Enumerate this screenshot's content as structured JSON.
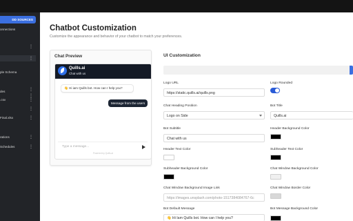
{
  "sidebar": {
    "add_button": "DD SOURCES",
    "items": [
      "onnections",
      "",
      "",
      "",
      "ple Schema",
      "",
      "",
      "des",
      ".csv",
      "",
      "Final.xlsx",
      "",
      "",
      "rations",
      "Schedules",
      ""
    ]
  },
  "page": {
    "title": "Chatbot Customization",
    "subtitle": "Customize the appearance and behavior of your chatbot to match your preferences."
  },
  "preview": {
    "title": "Chat Preview",
    "bot_title": "Quills.ai",
    "bot_subtitle": "Chat with us",
    "bot_message": "👋 Hi iam Quills bot. How can I help you?",
    "user_message": "Message from the users",
    "input_placeholder": "Type a message...",
    "powered_by": "Powered by Quills.ai"
  },
  "ui": {
    "title": "UI Customization",
    "logo_url_label": "Logo URL",
    "logo_url_value": "https://static.quills.ai/quills.png",
    "logo_rounded_label": "Logo Rounded",
    "logo_rounded_on": true,
    "heading_position_label": "Chat Heading Position",
    "heading_position_value": "Logo on Side",
    "bot_title_label": "Bot Title",
    "bot_title_value": "Quills.ai",
    "bot_subtitle_label": "Bot Subtitle",
    "bot_subtitle_value": "Chat with us",
    "header_bg_label": "Header Background Color",
    "header_text_label": "Header Text Color",
    "subheader_text_label": "Subheader Text Color",
    "subheader_bg_label": "Subheader Background Color",
    "chat_window_bg_label": "Chat Window Background Color",
    "chat_window_image_label": "Chat Window Background Image Link",
    "chat_window_image_value": "https://images.unsplash.com/photo-1517384084767-6c",
    "chat_window_border_label": "Chat Window Border Color",
    "bot_default_message_label": "Bot Default Message",
    "bot_default_message_value": "👋 Hi Iam Quills bot. How can I help you?",
    "bot_message_bg_label": "Bot Message Background Color"
  },
  "colors": {
    "accent": "#3b6fe0",
    "header_bg": "#000000",
    "header_text": "#ffffff",
    "subheader_text": "#000000",
    "subheader_bg": "#000000",
    "chat_window_bg": "#f0f0f0",
    "chat_window_border": "#d8d8d8",
    "bot_message_bg": "#000000"
  }
}
